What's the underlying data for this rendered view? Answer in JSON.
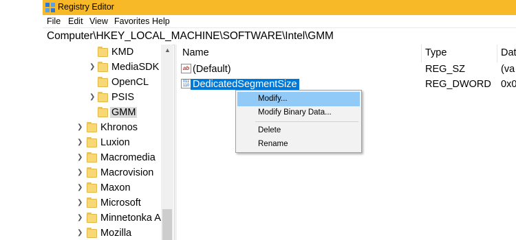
{
  "window": {
    "title": "Registry Editor"
  },
  "menubar": {
    "items": [
      "File",
      "Edit",
      "View",
      "Favorites",
      "Help"
    ]
  },
  "address": {
    "path": "Computer\\HKEY_LOCAL_MACHINE\\SOFTWARE\\Intel\\GMM"
  },
  "tree": {
    "items": [
      {
        "label": "KMD",
        "expandable": false,
        "selected": false
      },
      {
        "label": "MediaSDK",
        "expandable": true,
        "selected": false
      },
      {
        "label": "OpenCL",
        "expandable": false,
        "selected": false
      },
      {
        "label": "PSIS",
        "expandable": true,
        "selected": false
      },
      {
        "label": "GMM",
        "expandable": false,
        "selected": true
      },
      {
        "label": "Khronos",
        "expandable": true,
        "selected": false
      },
      {
        "label": "Luxion",
        "expandable": true,
        "selected": false
      },
      {
        "label": "Macromedia",
        "expandable": true,
        "selected": false
      },
      {
        "label": "Macrovision",
        "expandable": true,
        "selected": false
      },
      {
        "label": "Maxon",
        "expandable": true,
        "selected": false
      },
      {
        "label": "Microsoft",
        "expandable": true,
        "selected": false
      },
      {
        "label": "Minnetonka A",
        "expandable": true,
        "selected": false
      },
      {
        "label": "Mozilla",
        "expandable": true,
        "selected": false
      }
    ]
  },
  "list": {
    "columns": [
      "Name",
      "Type",
      "Dat"
    ],
    "rows": [
      {
        "name": "(Default)",
        "type": "REG_SZ",
        "data": "(va",
        "icon": "string-value-icon"
      },
      {
        "name": "DedicatedSegmentSize",
        "type": "REG_DWORD",
        "data": "0x0",
        "icon": "binary-value-icon"
      }
    ]
  },
  "context_menu": {
    "items": [
      "Modify...",
      "Modify Binary Data...",
      "Delete",
      "Rename"
    ]
  },
  "colors": {
    "titlebar": "#f7b928",
    "selection": "#0078d7",
    "menu_highlight": "#91c9f7"
  }
}
